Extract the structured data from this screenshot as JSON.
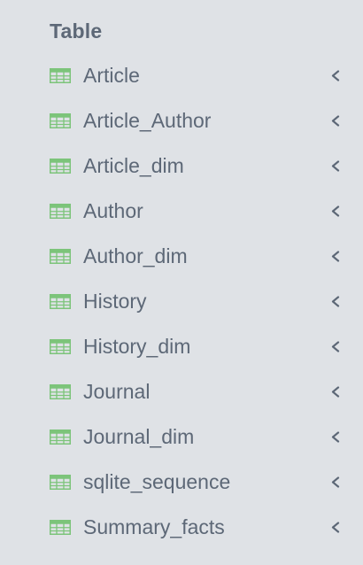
{
  "section": {
    "title": "Table"
  },
  "tables": [
    {
      "label": "Article",
      "icon": "table-icon"
    },
    {
      "label": "Article_Author",
      "icon": "table-icon"
    },
    {
      "label": "Article_dim",
      "icon": "table-icon"
    },
    {
      "label": "Author",
      "icon": "table-icon"
    },
    {
      "label": "Author_dim",
      "icon": "table-icon"
    },
    {
      "label": "History",
      "icon": "table-icon"
    },
    {
      "label": "History_dim",
      "icon": "table-icon"
    },
    {
      "label": "Journal",
      "icon": "table-icon"
    },
    {
      "label": "Journal_dim",
      "icon": "table-icon"
    },
    {
      "label": "sqlite_sequence",
      "icon": "table-icon"
    },
    {
      "label": "Summary_facts",
      "icon": "table-icon"
    }
  ],
  "colors": {
    "background": "#dfe2e6",
    "text": "#5d6877",
    "table_icon": "#7cc47a",
    "chevron": "#5d6877"
  }
}
